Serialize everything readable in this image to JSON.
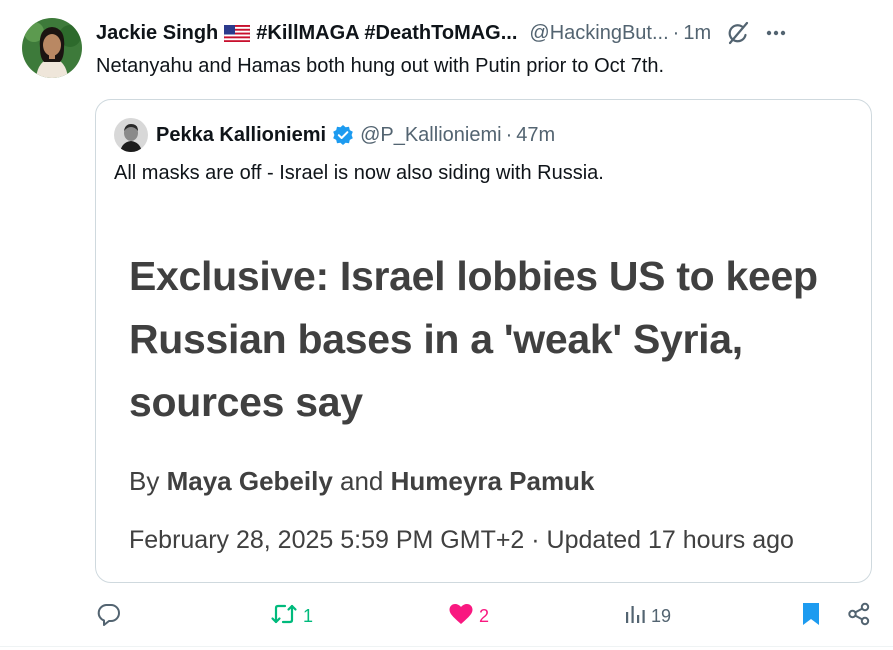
{
  "tweet": {
    "author_name": "Jackie Singh",
    "hashtags": "#KillMAGA #DeathToMAG...",
    "handle": "@HackingBut...",
    "time": "1m",
    "separator": "·",
    "text": "Netanyahu and Hamas both hung out with Putin prior to Oct 7th."
  },
  "quote": {
    "author_name": "Pekka Kallioniemi",
    "handle": "@P_Kallioniemi",
    "time": "47m",
    "separator": "·",
    "text": "All masks are off - Israel is now also siding with Russia.",
    "article": {
      "headline": "Exclusive: Israel lobbies US to keep Russian bases in a 'weak' Syria, sources say",
      "by": "By",
      "author1": "Maya Gebeily",
      "and": "and",
      "author2": "Humeyra Pamuk",
      "dateline": "February 28, 2025 5:59 PM GMT+2 · Updated 17 hours ago"
    }
  },
  "actions": {
    "retweets": "1",
    "likes": "2",
    "views": "19"
  },
  "colors": {
    "retweet": "#00ba7c",
    "like": "#f91880",
    "bookmark": "#1d9bf0",
    "verified": "#1d9bf0",
    "secondary_text": "#536471",
    "border": "#cfd9de"
  }
}
